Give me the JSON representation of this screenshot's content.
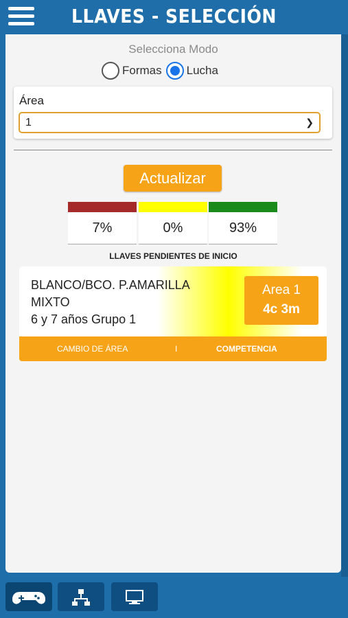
{
  "header": {
    "title": "LLAVES - SELECCIÓN"
  },
  "mode": {
    "label": "Selecciona Modo",
    "options": [
      "Formas",
      "Lucha"
    ],
    "selected": "Lucha"
  },
  "area": {
    "label": "Área",
    "selected": "1"
  },
  "update_button": "Actualizar",
  "stats": [
    {
      "value": "7%",
      "color": "#a52a2a"
    },
    {
      "value": "0%",
      "color": "#ffff00"
    },
    {
      "value": "93%",
      "color": "#1a8a1a"
    }
  ],
  "pending": {
    "title": "LLAVES PENDIENTES DE INICIO",
    "items": [
      {
        "line1": "BLANCO/BCO. P.AMARILLA",
        "line2": "MIXTO",
        "line3": "6 y 7 años Grupo 1",
        "area": "Area 1",
        "time": "4c 3m",
        "actions": {
          "change_area": "CAMBIO DE ÁREA",
          "separator": "I",
          "competition": "COMPETENCIA"
        }
      }
    ]
  },
  "bottom_tabs": [
    {
      "icon": "gamepad-icon"
    },
    {
      "icon": "tournament-bracket-icon"
    },
    {
      "icon": "monitor-icon"
    }
  ]
}
